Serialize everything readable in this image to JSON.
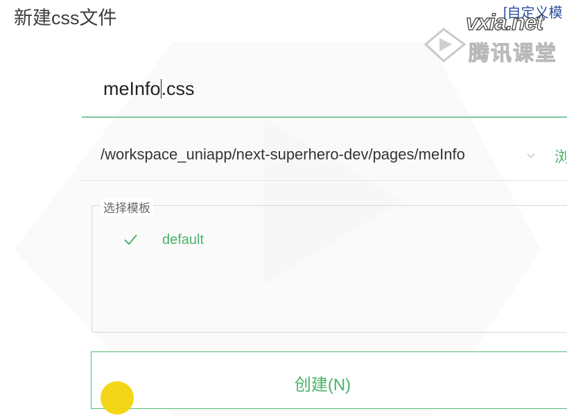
{
  "dialog": {
    "title": "新建css文件",
    "custom_link": "[自定义模"
  },
  "watermark": {
    "site": "vxia.net",
    "brand": "腾讯课堂"
  },
  "filename": {
    "before_caret": "meInfo",
    "after_caret": ".css"
  },
  "path": {
    "value": "/workspace_uniapp/next-superhero-dev/pages/meInfo",
    "browse_label": "浏"
  },
  "template": {
    "legend": "选择模板",
    "items": [
      {
        "label": "default",
        "selected": true
      }
    ]
  },
  "actions": {
    "create_label": "创建(N)"
  },
  "colors": {
    "accent": "#4bb36a",
    "field_underline": "#7cc79a",
    "cursor_highlight": "#f2d40c"
  },
  "icons": {
    "check": "check-icon",
    "chevron": "chevron-down-icon",
    "logo": "play-logo-icon"
  }
}
